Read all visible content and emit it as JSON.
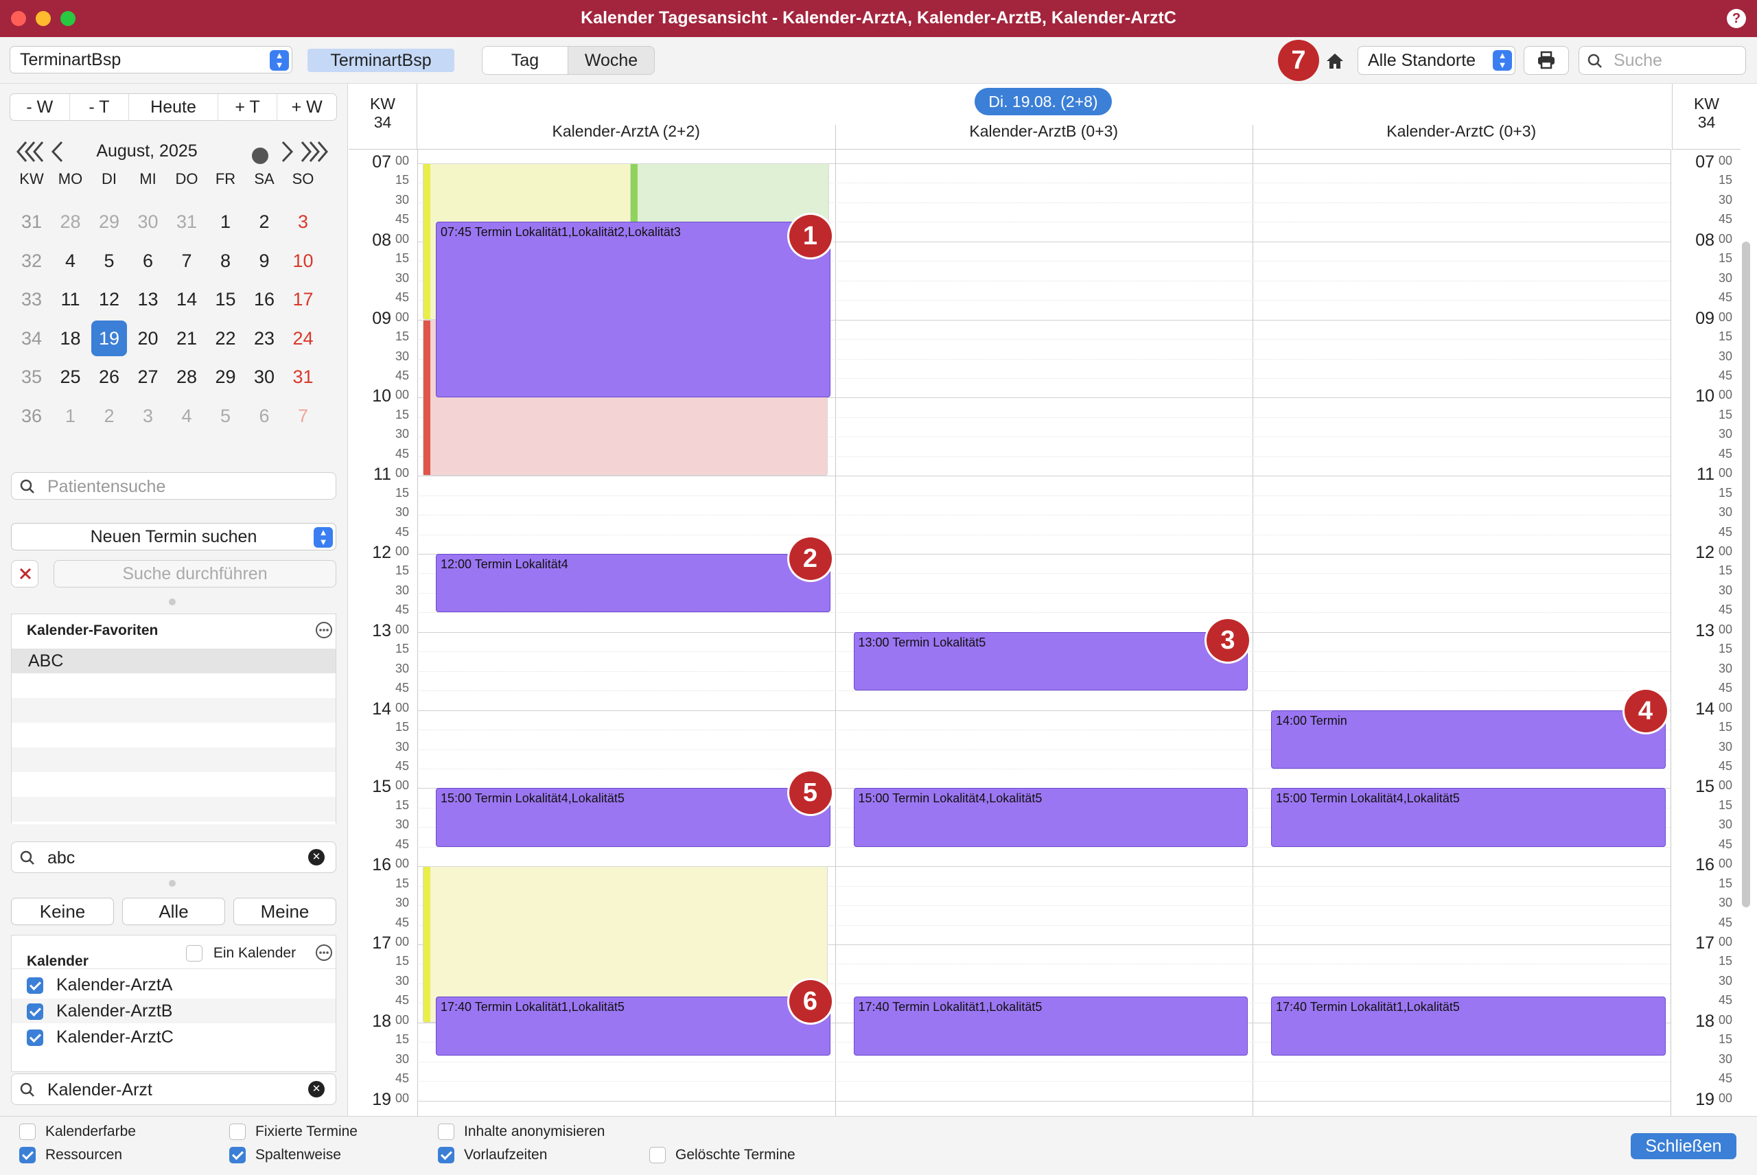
{
  "window": {
    "title": "Kalender Tagesansicht - Kalender-ArztA, Kalender-ArztB, Kalender-ArztC",
    "help": "?"
  },
  "toolbar": {
    "termintype_select": "TerminartBsp",
    "termintype_badge": "TerminartBsp",
    "view_tabs": [
      "Tag",
      "Woche"
    ],
    "active_view": "Tag",
    "location_select": "Alle Standorte",
    "search_placeholder": "Suche",
    "badge7": "7"
  },
  "navigator": {
    "buttons": [
      "- W",
      "- T",
      "Heute",
      "+ T",
      "+ W"
    ],
    "month_label": "August, 2025"
  },
  "mini_calendar": {
    "headers": [
      "KW",
      "MO",
      "DI",
      "MI",
      "DO",
      "FR",
      "SA",
      "SO"
    ],
    "weeks": [
      {
        "kw": "31",
        "days": [
          "28",
          "29",
          "30",
          "31",
          "1",
          "2",
          "3"
        ]
      },
      {
        "kw": "32",
        "days": [
          "4",
          "5",
          "6",
          "7",
          "8",
          "9",
          "10"
        ]
      },
      {
        "kw": "33",
        "days": [
          "11",
          "12",
          "13",
          "14",
          "15",
          "16",
          "17"
        ]
      },
      {
        "kw": "34",
        "days": [
          "18",
          "19",
          "20",
          "21",
          "22",
          "23",
          "24"
        ]
      },
      {
        "kw": "35",
        "days": [
          "25",
          "26",
          "27",
          "28",
          "29",
          "30",
          "31"
        ]
      },
      {
        "kw": "36",
        "days": [
          "1",
          "2",
          "3",
          "4",
          "5",
          "6",
          "7"
        ]
      }
    ],
    "selected": "19"
  },
  "patient_search": {
    "placeholder": "Patientensuche"
  },
  "appointment_search": {
    "select": "Neuen Termin suchen",
    "run_button": "Suche durchführen"
  },
  "favorites": {
    "title": "Kalender-Favoriten",
    "items": [
      "ABC"
    ],
    "filter_value": "abc"
  },
  "calendar_filter": {
    "buttons": [
      "Keine",
      "Alle",
      "Meine"
    ]
  },
  "calendars": {
    "title": "Kalender",
    "single_label": "Ein Kalender",
    "items": [
      "Kalender-ArztA",
      "Kalender-ArztB",
      "Kalender-ArztC"
    ],
    "filter_value": "Kalender-Arzt"
  },
  "day_view": {
    "week_label": "KW",
    "week_number": "34",
    "date_pill": "Di. 19.08. (2+8)",
    "columns": [
      "Kalender-ArztA (2+2)",
      "Kalender-ArztB (0+3)",
      "Kalender-ArztC (0+3)"
    ],
    "hours": [
      "07",
      "08",
      "09",
      "10",
      "11",
      "12",
      "13",
      "14",
      "15",
      "16",
      "17",
      "18",
      "19"
    ],
    "quarters": [
      "00",
      "15",
      "30",
      "45"
    ],
    "events": [
      {
        "col": 0,
        "start": 7.75,
        "end": 10.0,
        "label": "07:45 Termin Lokalität1,Lokalität2,Lokalität3"
      },
      {
        "col": 0,
        "start": 12.0,
        "end": 12.75,
        "label": "12:00 Termin Lokalität4"
      },
      {
        "col": 1,
        "start": 13.0,
        "end": 13.75,
        "label": "13:00 Termin Lokalität5"
      },
      {
        "col": 2,
        "start": 14.0,
        "end": 14.75,
        "label": "14:00 Termin"
      },
      {
        "col": 0,
        "start": 15.0,
        "end": 15.75,
        "label": "15:00 Termin Lokalität4,Lokalität5"
      },
      {
        "col": 1,
        "start": 15.0,
        "end": 15.75,
        "label": "15:00 Termin Lokalität4,Lokalität5"
      },
      {
        "col": 2,
        "start": 15.0,
        "end": 15.75,
        "label": "15:00 Termin Lokalität4,Lokalität5"
      },
      {
        "col": 0,
        "start": 17.67,
        "end": 18.42,
        "label": "17:40 Termin Lokalität1,Lokalität5"
      },
      {
        "col": 1,
        "start": 17.67,
        "end": 18.42,
        "label": "17:40 Termin Lokalität1,Lokalität5"
      },
      {
        "col": 2,
        "start": 17.67,
        "end": 18.42,
        "label": "17:40 Termin Lokalität1,Lokalität5"
      }
    ],
    "lead_times": [
      {
        "col": 0,
        "start": 7.0,
        "end": 9.0,
        "color": "#f4f6c8",
        "bar": "#e9ee4a"
      },
      {
        "col": 0,
        "start": 7.0,
        "end": 9.0,
        "color": "#dff0d5",
        "bar": "#8fd35b",
        "offset": true
      },
      {
        "col": 0,
        "start": 9.0,
        "end": 11.0,
        "color": "#f3d3d3",
        "bar": "#e0554a"
      },
      {
        "col": 0,
        "start": 16.0,
        "end": 18.0,
        "color": "#f7f6cf",
        "bar": "#e9ee4a"
      }
    ],
    "markers": [
      {
        "label": "1",
        "col": 0,
        "time": 7.92
      },
      {
        "label": "2",
        "col": 0,
        "time": 12.05
      },
      {
        "label": "3",
        "col": 1,
        "time": 13.1
      },
      {
        "label": "4",
        "col": 2,
        "time": 14.0
      },
      {
        "label": "5",
        "col": 0,
        "time": 15.05
      },
      {
        "label": "6",
        "col": 0,
        "time": 17.72
      }
    ]
  },
  "options": {
    "items": [
      {
        "label": "Kalenderfarbe",
        "checked": false
      },
      {
        "label": "Ressourcen",
        "checked": true
      },
      {
        "label": "Fixierte Termine",
        "checked": false
      },
      {
        "label": "Spaltenweise",
        "checked": true
      },
      {
        "label": "Inhalte anonymisieren",
        "checked": false
      },
      {
        "label": "Vorlaufzeiten",
        "checked": true
      },
      {
        "label": "Gelöschte Termine",
        "checked": false
      }
    ],
    "close_button": "Schließen"
  },
  "colors": {
    "titlebar": "#a3243d",
    "event": "#9b76f2",
    "accent": "#3b7fd6",
    "marker": "#c0292b"
  }
}
